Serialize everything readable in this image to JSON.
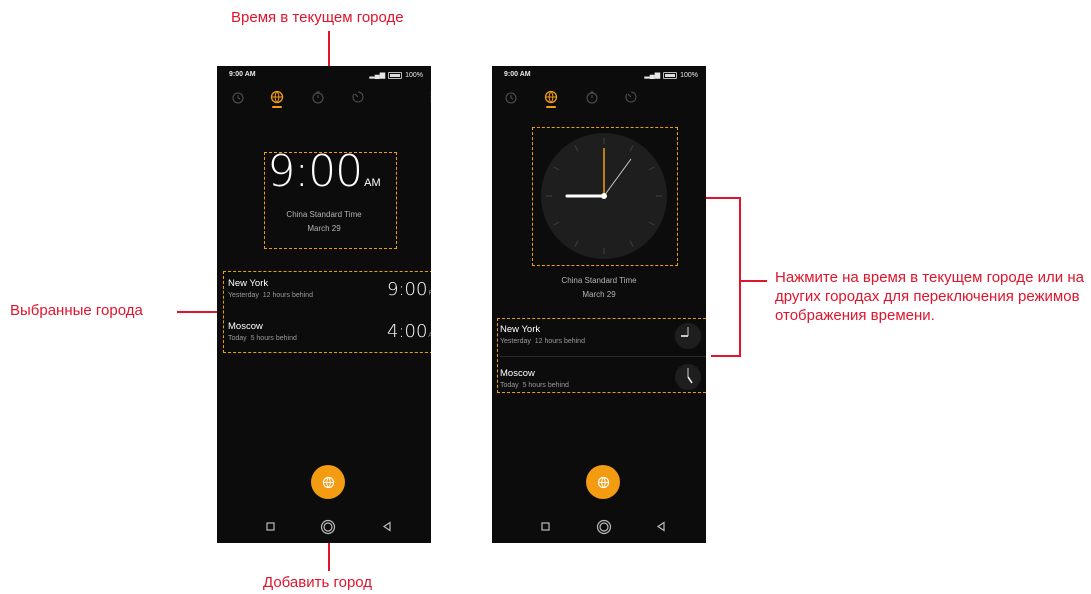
{
  "annotations": {
    "current_city_time": "Время в текущем городе",
    "selected_cities": "Выбранные города",
    "add_city": "Добавить город",
    "switch_mode": "Нажмите на время в текущем городе или на других городах для переключения режимов отображения времени."
  },
  "colors": {
    "accent": "#f39c12",
    "annotation": "#e0142d",
    "background": "#0c0c0c"
  },
  "icons": {
    "tabs": [
      "alarm-icon",
      "world-clock-icon",
      "stopwatch-icon",
      "timer-icon"
    ],
    "menu": "more-vert-icon",
    "fab": "globe-icon",
    "nav": [
      "square-icon",
      "home-circle-icon",
      "back-triangle-icon"
    ]
  },
  "phone_left": {
    "status": {
      "time": "9:00 AM",
      "battery": "100%"
    },
    "main_clock": {
      "time": "9:00",
      "ampm": "AM",
      "timezone": "China Standard Time",
      "date": "March 29"
    },
    "cities": [
      {
        "name": "New York",
        "day": "Yesterday",
        "offset": "12 hours behind",
        "time": "9:00",
        "ampm": "PM"
      },
      {
        "name": "Moscow",
        "day": "Today",
        "offset": "5 hours behind",
        "time": "4:00",
        "ampm": "AM"
      }
    ]
  },
  "phone_right": {
    "status": {
      "time": "9:00 AM",
      "battery": "100%"
    },
    "main_clock": {
      "timezone": "China Standard Time",
      "date": "March 29"
    },
    "cities": [
      {
        "name": "New York",
        "day": "Yesterday",
        "offset": "12 hours behind"
      },
      {
        "name": "Moscow",
        "day": "Today",
        "offset": "5 hours behind"
      }
    ]
  }
}
